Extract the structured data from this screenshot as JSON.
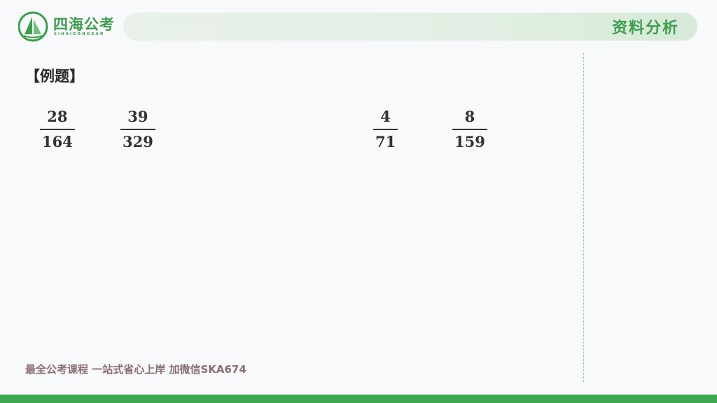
{
  "header": {
    "logo_cn": "四海公考",
    "logo_en": "SIHAIGONGKAO",
    "section_title": "资料分析"
  },
  "main": {
    "example_label": "【例题】",
    "fractions": [
      {
        "numerator": "28",
        "denominator": "164"
      },
      {
        "numerator": "39",
        "denominator": "329"
      },
      {
        "numerator": "4",
        "denominator": "71"
      },
      {
        "numerator": "8",
        "denominator": "159"
      }
    ]
  },
  "footer": {
    "text": "最全公考课程 一站式省心上岸 加微信SKA674"
  },
  "colors": {
    "brand_green": "#3e9e4f",
    "footer_text": "#8c6e72"
  }
}
